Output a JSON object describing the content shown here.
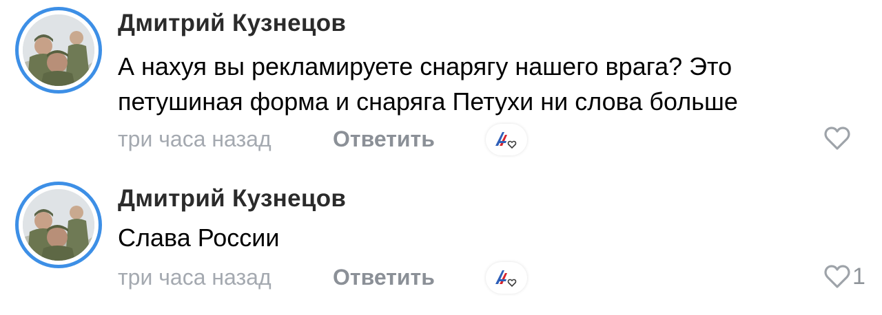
{
  "comments": [
    {
      "author": "Дмитрий Кузнецов",
      "lines": [
        "А нахуя вы рекламируете снарягу нашего врага? Это",
        "петушиная форма и снаряга Петухи ни слова больше"
      ],
      "time": "три часа назад",
      "reply_label": "Ответить",
      "likes": ""
    },
    {
      "author": "Дмитрий Кузнецов",
      "lines": [
        "Слава России"
      ],
      "time": "три часа назад",
      "reply_label": "Ответить",
      "likes": "1"
    }
  ],
  "icons": {
    "avatar": "avatar-photo",
    "reaction": "reaction-picker-icon",
    "like": "heart-outline-icon"
  },
  "colors": {
    "avatar_ring": "#3d8fe6",
    "author": "#2b2b2b",
    "meta": "#a4a9b0",
    "reply": "#8b9097",
    "heart": "#9ea3a9"
  }
}
